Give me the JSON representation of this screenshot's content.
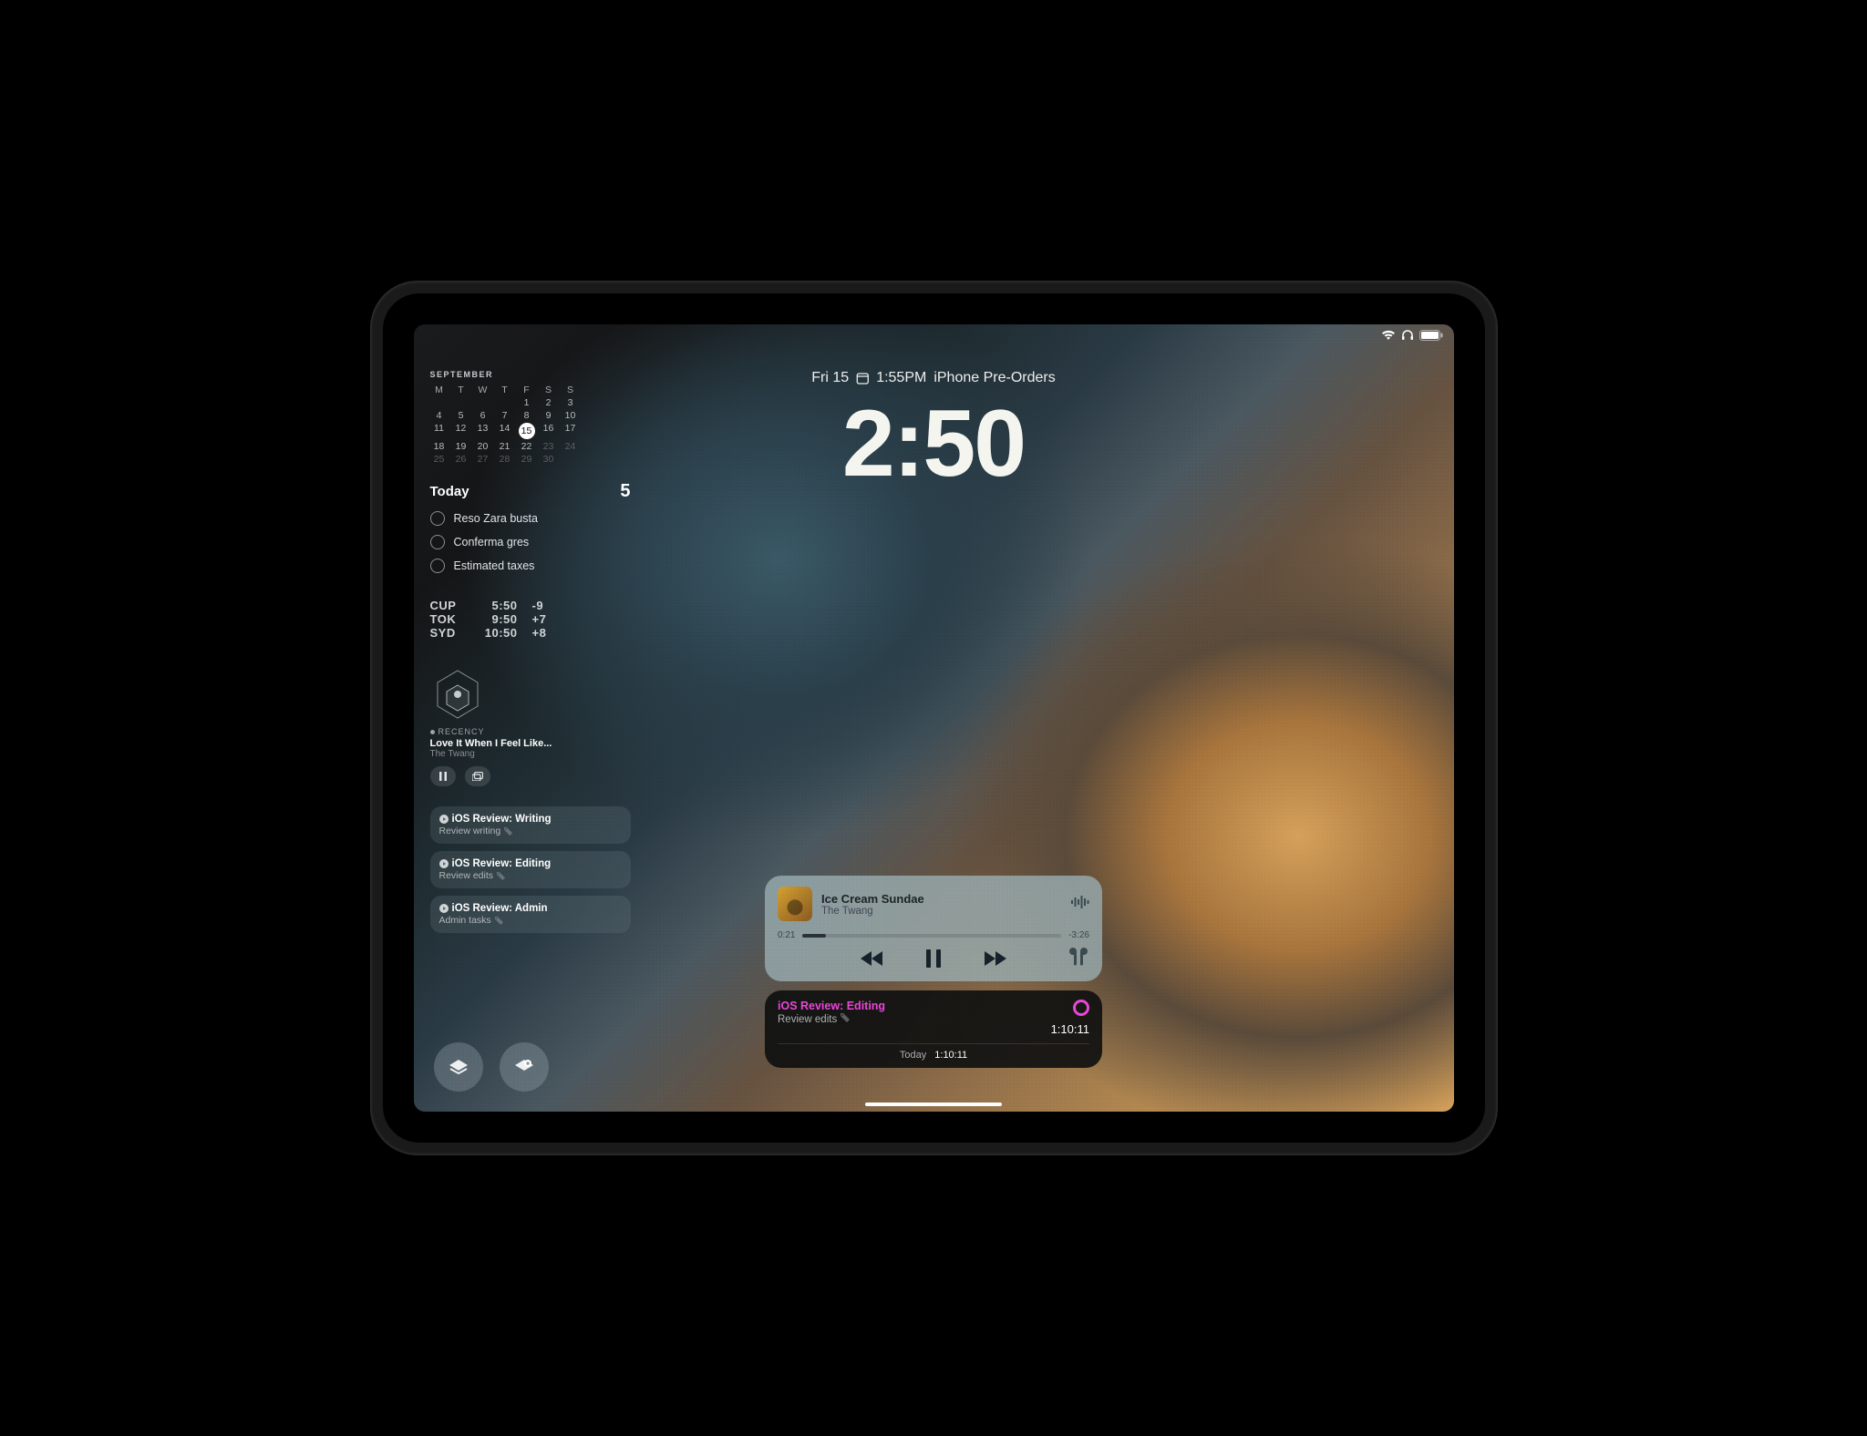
{
  "dateline": {
    "day": "Fri 15",
    "time": "1:55PM",
    "event": "iPhone Pre-Orders"
  },
  "clock": "2:50",
  "calendar": {
    "month": "SEPTEMBER",
    "headers": [
      "M",
      "T",
      "W",
      "T",
      "F",
      "S",
      "S"
    ],
    "rows": [
      [
        "",
        "",
        "",
        "",
        "1",
        "2",
        "3"
      ],
      [
        "4",
        "5",
        "6",
        "7",
        "8",
        "9",
        "10"
      ],
      [
        "11",
        "12",
        "13",
        "14",
        "15",
        "16",
        "17"
      ],
      [
        "18",
        "19",
        "20",
        "21",
        "22",
        "23",
        "24"
      ],
      [
        "25",
        "26",
        "27",
        "28",
        "29",
        "30",
        ""
      ]
    ],
    "today": "15",
    "dimAfter": "22"
  },
  "reminders": {
    "title": "Today",
    "count": "5",
    "items": [
      "Reso Zara busta",
      "Conferma gres",
      "Estimated taxes"
    ]
  },
  "clocks": [
    {
      "city": "CUP",
      "time": "5:50",
      "offset": "-9"
    },
    {
      "city": "TOK",
      "time": "9:50",
      "offset": "+7"
    },
    {
      "city": "SYD",
      "time": "10:50",
      "offset": "+8"
    }
  ],
  "miniMusic": {
    "label": "RECENCY",
    "title": "Love It When I Feel Like...",
    "artist": "The Twang"
  },
  "shortcuts": [
    {
      "title": "iOS Review: Writing",
      "subtitle": "Review writing"
    },
    {
      "title": "iOS Review: Editing",
      "subtitle": "Review edits"
    },
    {
      "title": "iOS Review: Admin",
      "subtitle": "Admin tasks"
    }
  ],
  "nowPlaying": {
    "title": "Ice Cream Sundae",
    "artist": "The Twang",
    "elapsed": "0:21",
    "remaining": "-3:26",
    "progressPct": 9
  },
  "timer": {
    "title": "iOS Review: Editing",
    "subtitle": "Review edits",
    "elapsed": "1:10:11",
    "todayLabel": "Today",
    "todayTime": "1:10:11"
  }
}
